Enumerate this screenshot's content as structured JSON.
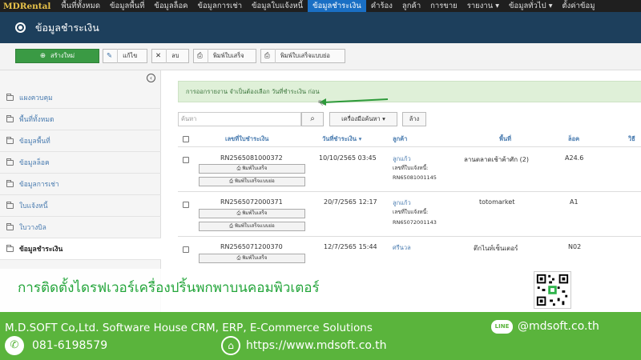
{
  "nav": {
    "brand": "MDRental",
    "items": [
      "พื้นที่ทั้งหมด",
      "ข้อมูลพื้นที่",
      "ข้อมูลล็อค",
      "ข้อมูลการเช่า",
      "ข้อมูลใบแจ้งหนี้",
      "ข้อมูลชำระเงิน",
      "คำร้อง",
      "ลูกค้า",
      "การขาย",
      "รายงาน ▾",
      "ข้อมูลทั่วไป ▾",
      "ตั้งค่าข้อมู"
    ]
  },
  "page": {
    "title": "ข้อมูลชำระเงิน"
  },
  "toolbar": {
    "new": "สร้างใหม่",
    "edit": "แก้ไข",
    "delete": "ลบ",
    "print_receipt": "พิมพ์ใบเสร็จ",
    "print_receipt_short": "พิมพ์ใบเสร็จแบบย่อ"
  },
  "sidebar": {
    "items": [
      "แผงควบคุม",
      "พื้นที่ทั้งหมด",
      "ข้อมูลพื้นที่",
      "ข้อมูลล็อค",
      "ข้อมูลการเช่า",
      "ใบแจ้งหนี้",
      "ใบวางบิล",
      "ข้อมูลชำระเงิน"
    ]
  },
  "alert": "การออกรายงาน จำเป็นต้องเลือก วันที่ชำระเงิน ก่อน",
  "search": {
    "placeholder": "ค้นหา",
    "tools": "เครื่องมือค้นหา ▾",
    "clear": "ล้าง"
  },
  "table": {
    "headers": [
      "เลขที่ใบชำระเงิน",
      "วันที่ชำระเงิน ▾",
      "ลูกค้า",
      "พื้นที่",
      "ล็อค",
      "วิธี"
    ],
    "btn_receipt": "พิมพ์ใบเสร็จ",
    "btn_receipt_short": "พิมพ์ใบเสร็จแบบย่อ",
    "invoice_label": "เลขที่ใบแจ้งหนี้:",
    "rows": [
      {
        "no": "RN2565081000372",
        "date": "10/10/2565 03:45",
        "customer": "ลูกแก้ว",
        "invoice": "RN65081001145",
        "area": "ลานตลาดเช้าค้าศัก (2)",
        "lock": "A24.6"
      },
      {
        "no": "RN2565072000371",
        "date": "20/7/2565 12:17",
        "customer": "ลูกแก้ว",
        "invoice": "RN65072001143",
        "area": "totomarket",
        "lock": "A1"
      },
      {
        "no": "RN2565071200370",
        "date": "12/7/2565 15:44",
        "customer": "ศรีนวล",
        "invoice": "",
        "area": "ตึกไนท์เซ็นเตอร์",
        "lock": "N02"
      }
    ]
  },
  "overlay": {
    "caption": "การติดตั้งไดรฟเวอร์เครื่องปริ้นพกพาบนคอมพิวเตอร์",
    "company": "M.D.SOFT Co,Ltd. Software House CRM, ERP, E-Commerce Solutions",
    "phone": "081-6198579",
    "website": "https://www.mdsoft.co.th",
    "line_id": "@mdsoft.co.th",
    "line_label": "LINE"
  },
  "colors": {
    "nav": "#1f1f1f",
    "active_tab": "#1a6fc4",
    "header": "#1d3f5c",
    "accent_green": "#5ab43c",
    "link": "#4a7cb0"
  }
}
